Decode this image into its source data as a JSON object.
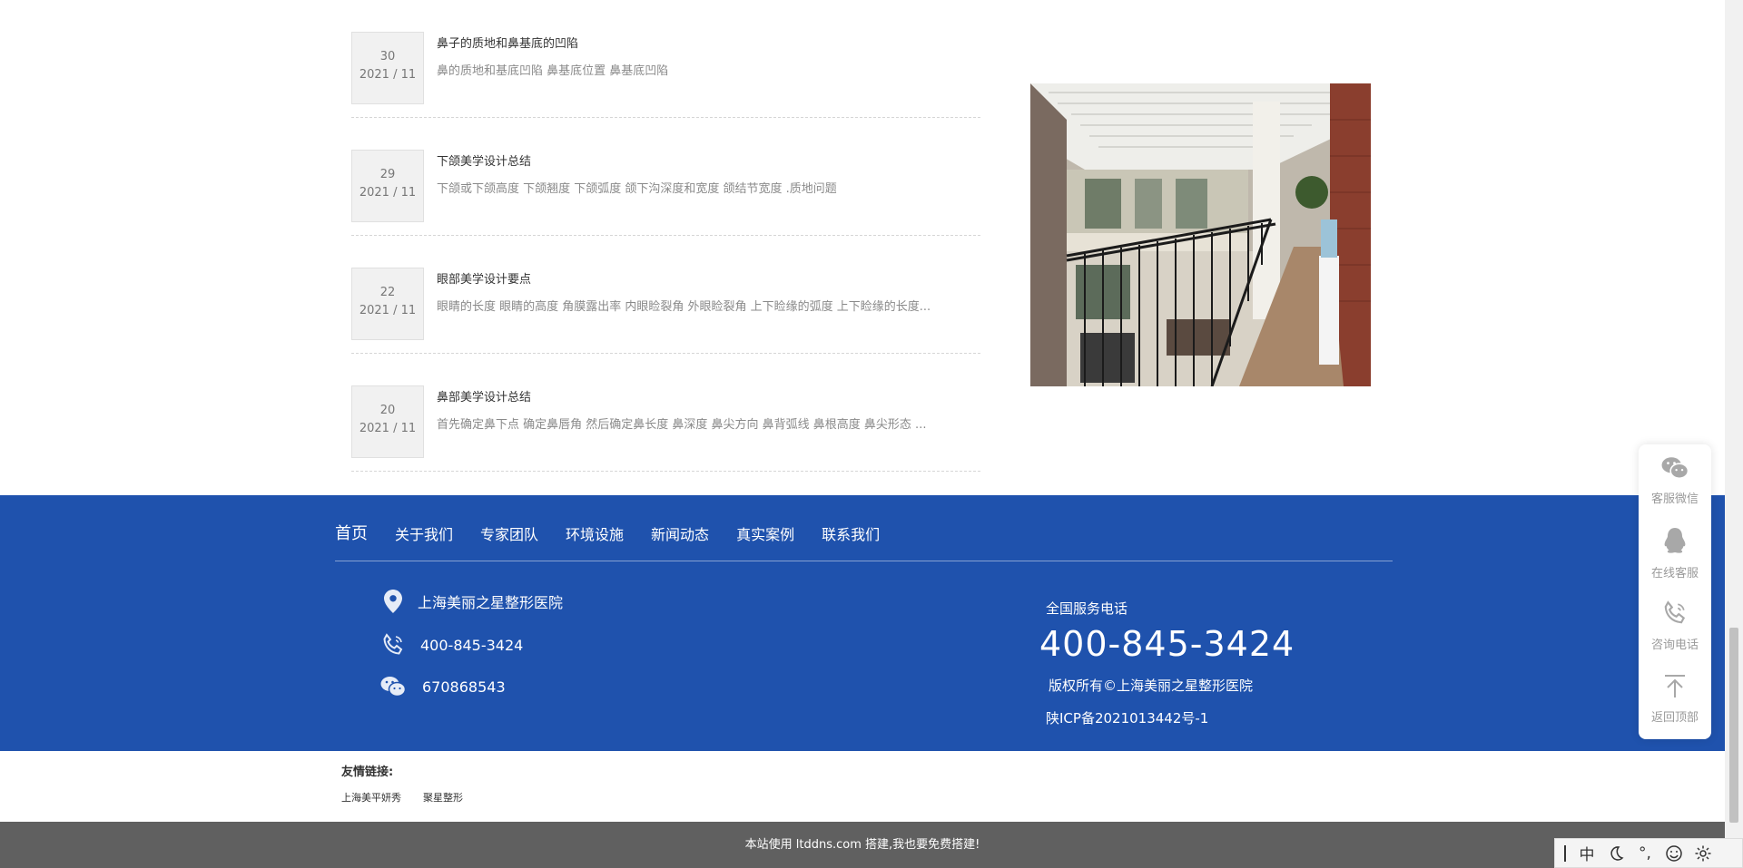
{
  "news": [
    {
      "day": "30",
      "ym": "2021 / 11",
      "title": "鼻子的质地和鼻基底的凹陷",
      "desc": "鼻的质地和基底凹陷 鼻基底位置 鼻基底凹陷"
    },
    {
      "day": "29",
      "ym": "2021 / 11",
      "title": "下颌美学设计总结",
      "desc": "下颌或下颌高度 下颌翘度 下颌弧度 颌下沟深度和宽度 颌结节宽度 .质地问题"
    },
    {
      "day": "22",
      "ym": "2021 / 11",
      "title": "眼部美学设计要点",
      "desc": "眼睛的长度 眼睛的高度 角膜露出率 内眼睑裂角 外眼睑裂角 上下睑缘的弧度 上下睑缘的长度..."
    },
    {
      "day": "20",
      "ym": "2021 / 11",
      "title": "鼻部美学设计总结",
      "desc": "首先确定鼻下点 确定鼻唇角 然后确定鼻长度 鼻深度 鼻尖方向 鼻背弧线 鼻根高度 鼻尖形态 ..."
    }
  ],
  "footer": {
    "nav": [
      "首页",
      "关于我们",
      "专家团队",
      "环境设施",
      "新闻动态",
      "真实案例",
      "联系我们"
    ],
    "address": "上海美丽之星整形医院",
    "phone": "400-845-3424",
    "wechat": "670868543",
    "service_label": "全国服务电话",
    "service_phone": "400-845-3424",
    "copyright": "版权所有©上海美丽之星整形医院",
    "icp": "陕ICP备2021013442号-1"
  },
  "friends": {
    "head": "友情链接:",
    "links": [
      "上海美平妍秀",
      "聚星整形"
    ]
  },
  "bottom_bar": "本站使用 ltddns.com 搭建,我也要免费搭建!",
  "side_panel": {
    "wechat": "客服微信",
    "online": "在线客服",
    "phone": "咨询电话",
    "top": "返回顶部"
  },
  "ime": {
    "mode": "中",
    "punct": "°,"
  },
  "colors": {
    "footer_bg": "#1f52ad",
    "bottom_bg": "#606060"
  }
}
